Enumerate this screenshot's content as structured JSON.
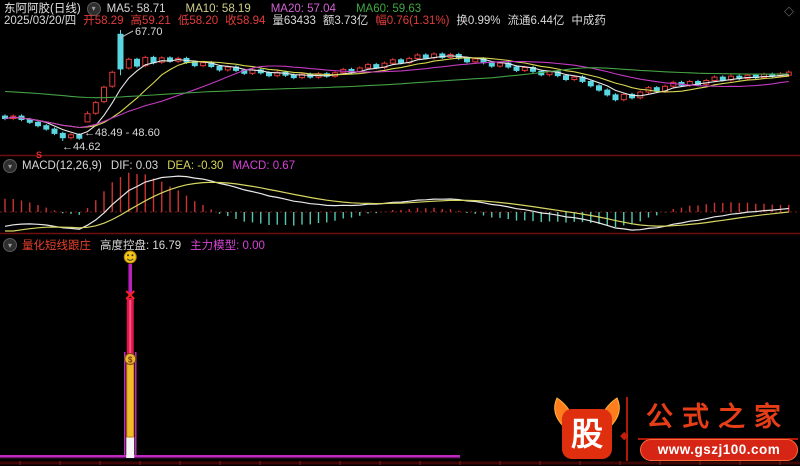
{
  "window": {
    "diamond_icon": "◇",
    "collapse_icon": "▾"
  },
  "header": {
    "stock_title": "东阿阿胶(日线)",
    "ma_values": [
      {
        "label": "MA5: 58.71",
        "color": "#d9d9d9"
      },
      {
        "label": "MA10: 58.19",
        "color": "#cfcf8a"
      },
      {
        "label": "MA20: 57.04",
        "color": "#d45fd4"
      },
      {
        "label": "MA60: 59.63",
        "color": "#41a941"
      }
    ],
    "info_segments": [
      {
        "text": "2025/03/20/四",
        "color": "#d9d9d9"
      },
      {
        "text": "开58.29",
        "color": "#e23b3b"
      },
      {
        "text": "高59.21",
        "color": "#e23b3b"
      },
      {
        "text": "低58.20",
        "color": "#e23b3b"
      },
      {
        "text": "收58.94",
        "color": "#e23b3b"
      },
      {
        "text": "量63433",
        "color": "#d9d9d9"
      },
      {
        "text": "额3.73亿",
        "color": "#d9d9d9"
      },
      {
        "text": "幅0.76(1.31%)",
        "color": "#e23b3b"
      },
      {
        "text": "换0.99%",
        "color": "#d9d9d9"
      },
      {
        "text": "流通6.44亿",
        "color": "#d9d9d9"
      },
      {
        "text": "中成药",
        "color": "#d9d9d9"
      }
    ]
  },
  "macd_panel": {
    "name": "MACD(12,26,9)",
    "dif": "DIF: 0.03",
    "dea": "DEA: -0.30",
    "macd": "MACD: 0.67"
  },
  "signal_panel": {
    "name": "量化短线跟庄",
    "control": "高度控盘: 16.79",
    "model": "主力模型: 0.00"
  },
  "annotations": {
    "peak": "67.70",
    "gap": "←48.49 - 48.60",
    "low": "←44.62",
    "marker": "S"
  },
  "watermark": {
    "logo_char": "股",
    "brand": "公式之家",
    "url": "www.gszj100.com"
  },
  "chart_data": {
    "type": "candlestick",
    "title": "东阿阿胶(日线)",
    "price_points": {
      "peak_high": 67.7,
      "gap_low": 48.49,
      "gap_high": 48.6,
      "low": 44.62,
      "last_open": 58.29,
      "last_high": 59.21,
      "last_low": 58.2,
      "last_close": 58.94
    },
    "indicator_values": {
      "ma5": 58.71,
      "ma10": 58.19,
      "ma20": 57.04,
      "ma60": 59.63,
      "dif": 0.03,
      "dea": -0.3,
      "macd": 0.67,
      "kongpan": 16.79,
      "zhuli_model": 0.0
    },
    "ylim": [
      44.62,
      67.7
    ],
    "candles": [
      [
        49.8,
        49.3
      ],
      [
        49.3,
        49.8
      ],
      [
        49.8,
        49.1
      ],
      [
        49.1,
        48.5
      ],
      [
        48.5,
        47.8
      ],
      [
        47.8,
        47.1
      ],
      [
        47.1,
        46.2
      ],
      [
        46.2,
        45.3
      ],
      [
        45.3,
        45.9
      ],
      [
        45.9,
        45.2
      ],
      [
        48.6,
        50.3
      ],
      [
        50.4,
        52.6
      ],
      [
        52.8,
        55.8
      ],
      [
        56.0,
        58.9
      ],
      [
        66.8,
        59.6
      ],
      [
        59.8,
        61.6
      ],
      [
        61.6,
        60.2
      ],
      [
        60.3,
        62.0
      ],
      [
        62.0,
        60.9
      ],
      [
        61.0,
        61.9
      ],
      [
        61.9,
        61.2
      ],
      [
        61.2,
        61.8
      ],
      [
        61.8,
        61.0
      ],
      [
        61.0,
        60.3
      ],
      [
        60.3,
        60.9
      ],
      [
        60.9,
        60.1
      ],
      [
        60.1,
        59.4
      ],
      [
        59.4,
        60.0
      ],
      [
        60.0,
        59.3
      ],
      [
        59.3,
        58.7
      ],
      [
        58.7,
        59.4
      ],
      [
        59.4,
        58.8
      ],
      [
        58.8,
        58.2
      ],
      [
        58.2,
        58.9
      ],
      [
        58.9,
        58.3
      ],
      [
        58.3,
        57.8
      ],
      [
        57.8,
        58.5
      ],
      [
        58.5,
        57.9
      ],
      [
        57.9,
        58.6
      ],
      [
        58.6,
        58.1
      ],
      [
        58.1,
        58.8
      ],
      [
        58.8,
        59.5
      ],
      [
        59.5,
        59.0
      ],
      [
        59.0,
        59.8
      ],
      [
        59.8,
        60.5
      ],
      [
        60.5,
        59.9
      ],
      [
        59.9,
        60.8
      ],
      [
        60.8,
        61.5
      ],
      [
        61.5,
        60.9
      ],
      [
        60.9,
        61.8
      ],
      [
        61.8,
        62.5
      ],
      [
        62.5,
        61.9
      ],
      [
        61.9,
        62.7
      ],
      [
        62.7,
        62.0
      ],
      [
        62.0,
        62.6
      ],
      [
        62.6,
        61.8
      ],
      [
        61.8,
        61.1
      ],
      [
        61.1,
        61.7
      ],
      [
        61.7,
        60.9
      ],
      [
        60.9,
        60.2
      ],
      [
        60.2,
        60.8
      ],
      [
        60.8,
        60.0
      ],
      [
        60.0,
        59.3
      ],
      [
        59.3,
        59.9
      ],
      [
        59.9,
        59.1
      ],
      [
        59.1,
        58.4
      ],
      [
        58.4,
        59.0
      ],
      [
        59.0,
        58.2
      ],
      [
        58.2,
        57.4
      ],
      [
        57.4,
        57.9
      ],
      [
        57.9,
        57.0
      ],
      [
        57.0,
        56.1
      ],
      [
        56.1,
        55.2
      ],
      [
        55.2,
        54.2
      ],
      [
        54.2,
        53.2
      ],
      [
        53.2,
        54.3
      ],
      [
        54.3,
        53.6
      ],
      [
        53.6,
        54.8
      ],
      [
        54.8,
        55.7
      ],
      [
        55.7,
        55.0
      ],
      [
        55.0,
        56.0
      ],
      [
        56.0,
        56.8
      ],
      [
        56.8,
        56.2
      ],
      [
        56.2,
        57.0
      ],
      [
        57.0,
        56.4
      ],
      [
        56.4,
        57.2
      ],
      [
        57.2,
        57.9
      ],
      [
        57.9,
        57.3
      ],
      [
        57.3,
        58.1
      ],
      [
        58.1,
        57.6
      ],
      [
        57.6,
        58.3
      ],
      [
        58.3,
        57.8
      ],
      [
        57.8,
        58.5
      ],
      [
        58.5,
        58.1
      ],
      [
        58.1,
        58.6
      ],
      [
        58.3,
        58.94
      ]
    ],
    "wick_overrides": {
      "7": {
        "l": 44.62
      },
      "10": {
        "l": 48.49,
        "h": 50.8
      },
      "14": {
        "l": 58.3,
        "h": 67.7
      }
    },
    "ma_periods": [
      5,
      10,
      20,
      60
    ],
    "macd_params": {
      "fast": 12,
      "slow": 26,
      "signal": 9
    },
    "signal_spike": {
      "index": 15
    },
    "colors": {
      "up": "#df3838",
      "down": "#5ad6e2",
      "ma5": "#e6e6e6",
      "ma10": "#d8d850",
      "ma20": "#c23ac2",
      "ma60": "#44a044",
      "macd_up": "#cc3333",
      "macd_down": "#55c8b0",
      "dif_line": "#e8e8e8",
      "dea_line": "#d6d662",
      "zero_line": "#7a1a1a",
      "panel_divider": "#6e0f0f",
      "signal_baseline": "#c028c0",
      "spike_magenta": "#bb22bb",
      "spike_crimson": "#e01648",
      "spike_gold": "#edbe2a",
      "spike_white": "#f5f5f5",
      "smiley": "#f5c518",
      "coin": "#e8b830"
    }
  }
}
